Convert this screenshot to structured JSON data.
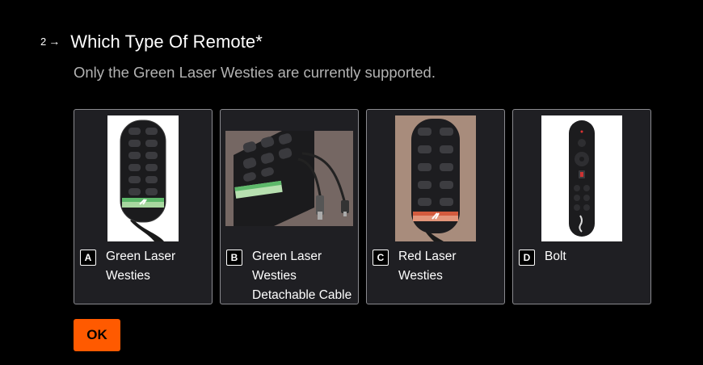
{
  "question": {
    "number": "2",
    "arrow": "→",
    "title": "Which Type Of Remote*",
    "subtitle": "Only the Green Laser Westies are currently supported."
  },
  "choices": [
    {
      "key": "A",
      "label": "Green Laser Westies",
      "image": "green-laser-remote"
    },
    {
      "key": "B",
      "label": "Green Laser Westies Detachable Cable",
      "image": "green-laser-detachable-remote"
    },
    {
      "key": "C",
      "label": "Red Laser Westies",
      "image": "red-laser-remote"
    },
    {
      "key": "D",
      "label": "Bolt",
      "image": "bolt-remote"
    }
  ],
  "ok_button": {
    "label": "OK"
  },
  "colors": {
    "background": "#000000",
    "card": "#1f1f23",
    "card_border": "#8a8a8f",
    "accent": "#ff5a00",
    "subtitle": "#b3b3b3"
  }
}
